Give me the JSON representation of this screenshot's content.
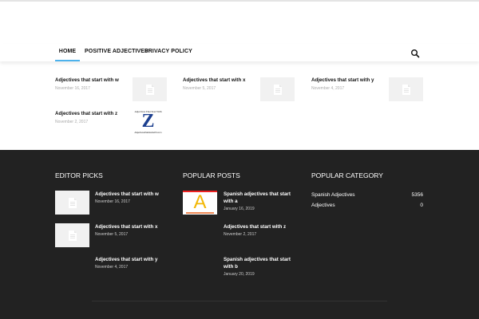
{
  "nav": {
    "items": [
      {
        "label": "HOME"
      },
      {
        "label": "POSITIVE ADJECTIVES"
      },
      {
        "label": "PRIVACY POLICY"
      }
    ]
  },
  "posts": [
    {
      "title": "Adjectives that start with w",
      "date": "November 16, 2017"
    },
    {
      "title": "Adjectives that start with x",
      "date": "November 5, 2017"
    },
    {
      "title": "Adjectives that start with y",
      "date": "November 4, 2017"
    },
    {
      "title": "Adjectives that start with z",
      "date": "November 2, 2017"
    }
  ],
  "z_thumb": {
    "top": "Adjectives That Start With",
    "letter": "Z",
    "bottom": "Adjectivesthatstartwith.com"
  },
  "editor_picks": {
    "heading": "EDITOR PICKS",
    "posts": [
      {
        "title": "Adjectives that start with w",
        "date": "November 16, 2017"
      },
      {
        "title": "Adjectives that start with x",
        "date": "November 5, 2017"
      },
      {
        "title": "Adjectives that start with y",
        "date": "November 4, 2017"
      }
    ]
  },
  "popular_posts": {
    "heading": "POPULAR POSTS",
    "a_letter": "A",
    "posts": [
      {
        "title": "Spanish adjectives that start with a",
        "date": "January 16, 2019"
      },
      {
        "title": "Adjectives that start with z",
        "date": "November 2, 2017"
      },
      {
        "title": "Spanish adjectives that start with b",
        "date": "January 20, 2019"
      }
    ]
  },
  "popular_category": {
    "heading": "POPULAR CATEGORY",
    "items": [
      {
        "name": "Spanish Adjectives",
        "count": "5356"
      },
      {
        "name": "Adjectives",
        "count": "0"
      }
    ]
  },
  "colors": {
    "accent": "#4db2ec",
    "footer_bg": "#222222"
  }
}
